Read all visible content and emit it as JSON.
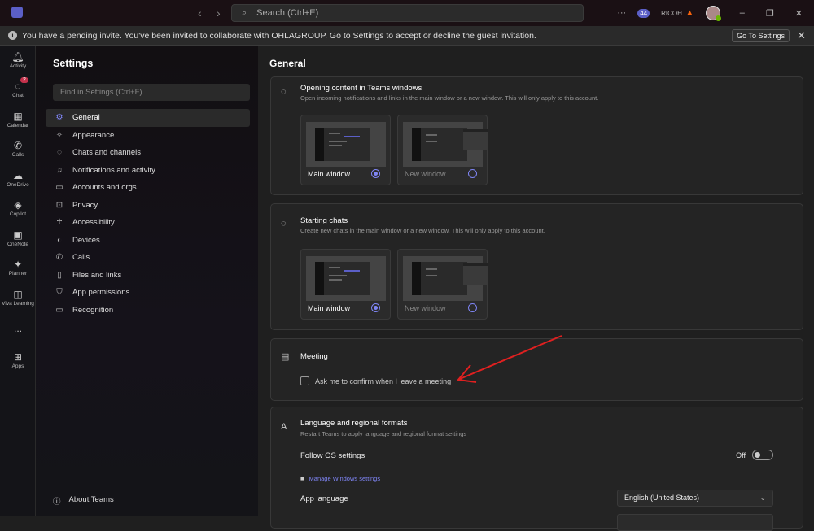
{
  "titlebar": {
    "search_placeholder": "Search (Ctrl+E)",
    "notifications_count": "44",
    "org": "RICOH"
  },
  "banner": {
    "message": "You have a pending invite. You've been invited to collaborate with OHLAGROUP. Go to Settings to accept or decline the guest invitation.",
    "button": "Go To Settings"
  },
  "rail": [
    {
      "label": "Activity",
      "icon": "bell-icon"
    },
    {
      "label": "Chat",
      "icon": "chat-icon",
      "badge": "2"
    },
    {
      "label": "Calendar",
      "icon": "calendar-icon"
    },
    {
      "label": "Calls",
      "icon": "phone-icon"
    },
    {
      "label": "OneDrive",
      "icon": "cloud-icon"
    },
    {
      "label": "Copilot",
      "icon": "copilot-icon"
    },
    {
      "label": "OneNote",
      "icon": "onenote-icon"
    },
    {
      "label": "Planner",
      "icon": "planner-icon"
    },
    {
      "label": "Viva Learning",
      "icon": "learning-icon"
    },
    {
      "label": "...",
      "icon": "more-icon"
    },
    {
      "label": "Apps",
      "icon": "plus-icon"
    }
  ],
  "settings": {
    "title": "Settings",
    "find_placeholder": "Find in Settings (Ctrl+F)",
    "menu": [
      "General",
      "Appearance",
      "Chats and channels",
      "Notifications and activity",
      "Accounts and orgs",
      "Privacy",
      "Accessibility",
      "Devices",
      "Calls",
      "Files and links",
      "App permissions",
      "Recognition"
    ],
    "about": "About Teams"
  },
  "main": {
    "title": "General",
    "opening": {
      "title": "Opening content in Teams windows",
      "subtitle": "Open incoming notifications and links in the main window or a new window. This will only apply to this account.",
      "options": [
        "Main window",
        "New window"
      ],
      "selected": "Main window"
    },
    "starting": {
      "title": "Starting chats",
      "subtitle": "Create new chats in the main window or a new window. This will only apply to this account.",
      "options": [
        "Main window",
        "New window"
      ],
      "selected": "Main window"
    },
    "meeting": {
      "title": "Meeting",
      "checkbox": "Ask me to confirm when I leave a meeting",
      "checked": false
    },
    "language": {
      "title": "Language and regional formats",
      "subtitle": "Restart Teams to apply language and regional format settings",
      "follow_os": "Follow OS settings",
      "follow_os_state": "Off",
      "manage_link": "Manage Windows settings",
      "app_language_label": "App language",
      "app_language": "English (United States)"
    }
  },
  "annotation_color": "#e02020"
}
